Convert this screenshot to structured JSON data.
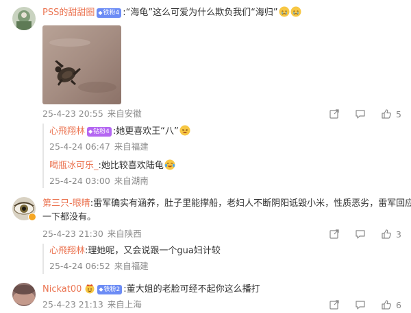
{
  "comments": [
    {
      "user": "PSS的甜甜圈",
      "badge": "铁粉4",
      "text": ":“海龟”这么可爱为什么欺负我们“海归”",
      "time": "25-4-23 20:55",
      "location": "来自安徽",
      "likes": "5",
      "replies": [
        {
          "user": "心飛翔林",
          "badge": "钻粉4",
          "text": ":她更喜欢王“八”",
          "time": "25-4-24 06:47",
          "location": "来自福建"
        },
        {
          "user": "喝瓶冰可乐_",
          "text": ":她比较喜欢陆龟",
          "time": "25-4-24 03:00",
          "location": "来自湖南"
        }
      ]
    },
    {
      "user": "第三只-眼睛",
      "text_line1": ":雷军确实有涵养，肚子里能撑船，老妇人不断阴阳诋毁小米，性质恶劣，雷军回应",
      "text_line2": "一下都没有。",
      "time": "25-4-23 21:30",
      "location": "来自陕西",
      "likes": "3",
      "replies": [
        {
          "user": "心飛翔林",
          "text": ":理她呢，又会说跟一个gua妇计较",
          "time": "25-4-24 06:52",
          "location": "来自福建"
        }
      ]
    },
    {
      "user": "Nickat00",
      "badge": "铁粉2",
      "text": ":董大姐的老脸可经不起你这么播打",
      "time": "25-4-23 21:13",
      "location": "来自上海",
      "likes": "6"
    }
  ],
  "icons": {
    "share": "share-icon",
    "comment": "comment-icon",
    "like": "thumbs-up-icon"
  },
  "colors": {
    "username": "#eb7350",
    "meta": "#8a8a8a",
    "badge_blue": "#6c8cf5",
    "badge_purple": "#b467f2"
  }
}
